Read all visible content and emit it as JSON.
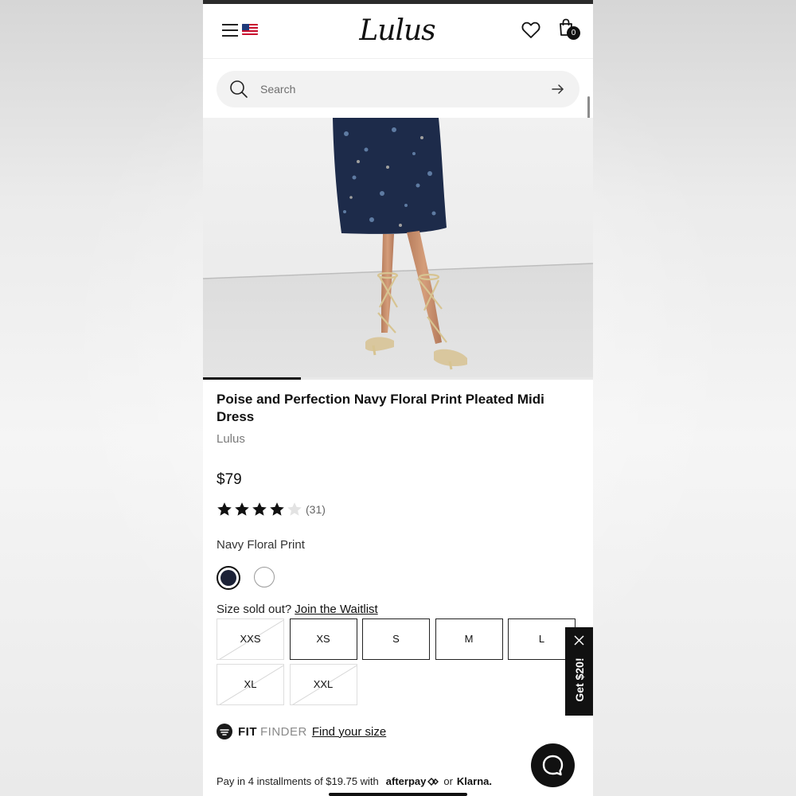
{
  "header": {
    "logo": "Lulus",
    "bag_count": "0"
  },
  "search": {
    "placeholder": "Search"
  },
  "carousel": {
    "progress": 0.25
  },
  "product": {
    "title": "Poise and Perfection Navy Floral Print Pleated Midi Dress",
    "brand": "Lulus",
    "price": "$79",
    "rating": 4,
    "rating_max": 5,
    "review_count": "(31)",
    "color_label": "Navy Floral Print",
    "swatches": [
      {
        "name": "navy",
        "color": "#1c2237",
        "selected": true
      },
      {
        "name": "white",
        "color": "#ffffff",
        "selected": false
      }
    ]
  },
  "sizes": {
    "prompt": "Size sold out?",
    "waitlist_link": "Join the Waitlist",
    "options": [
      {
        "label": "XXS",
        "sold_out": true
      },
      {
        "label": "XS",
        "sold_out": false
      },
      {
        "label": "S",
        "sold_out": false
      },
      {
        "label": "M",
        "sold_out": false
      },
      {
        "label": "L",
        "sold_out": false
      },
      {
        "label": "XL",
        "sold_out": true
      },
      {
        "label": "XXL",
        "sold_out": true
      }
    ]
  },
  "fit_finder": {
    "brand_strong": "FIT",
    "brand_light": "FINDER",
    "link": "Find your size"
  },
  "payment": {
    "text": "Pay in 4 installments of $19.75 with",
    "afterpay": "afterpay",
    "or": "or",
    "klarna": "Klarna."
  },
  "promo": {
    "label": "Get $20!"
  },
  "icons": {
    "menu": "hamburger-icon",
    "flag": "us-flag-icon",
    "wishlist": "heart-icon",
    "bag": "shopping-bag-icon",
    "search": "search-icon",
    "submit": "arrow-right-icon",
    "chat": "chat-icon",
    "close": "close-icon"
  },
  "colors": {
    "accent": "#111111",
    "navy": "#1c2237",
    "sold_out_border": "#dedede"
  }
}
